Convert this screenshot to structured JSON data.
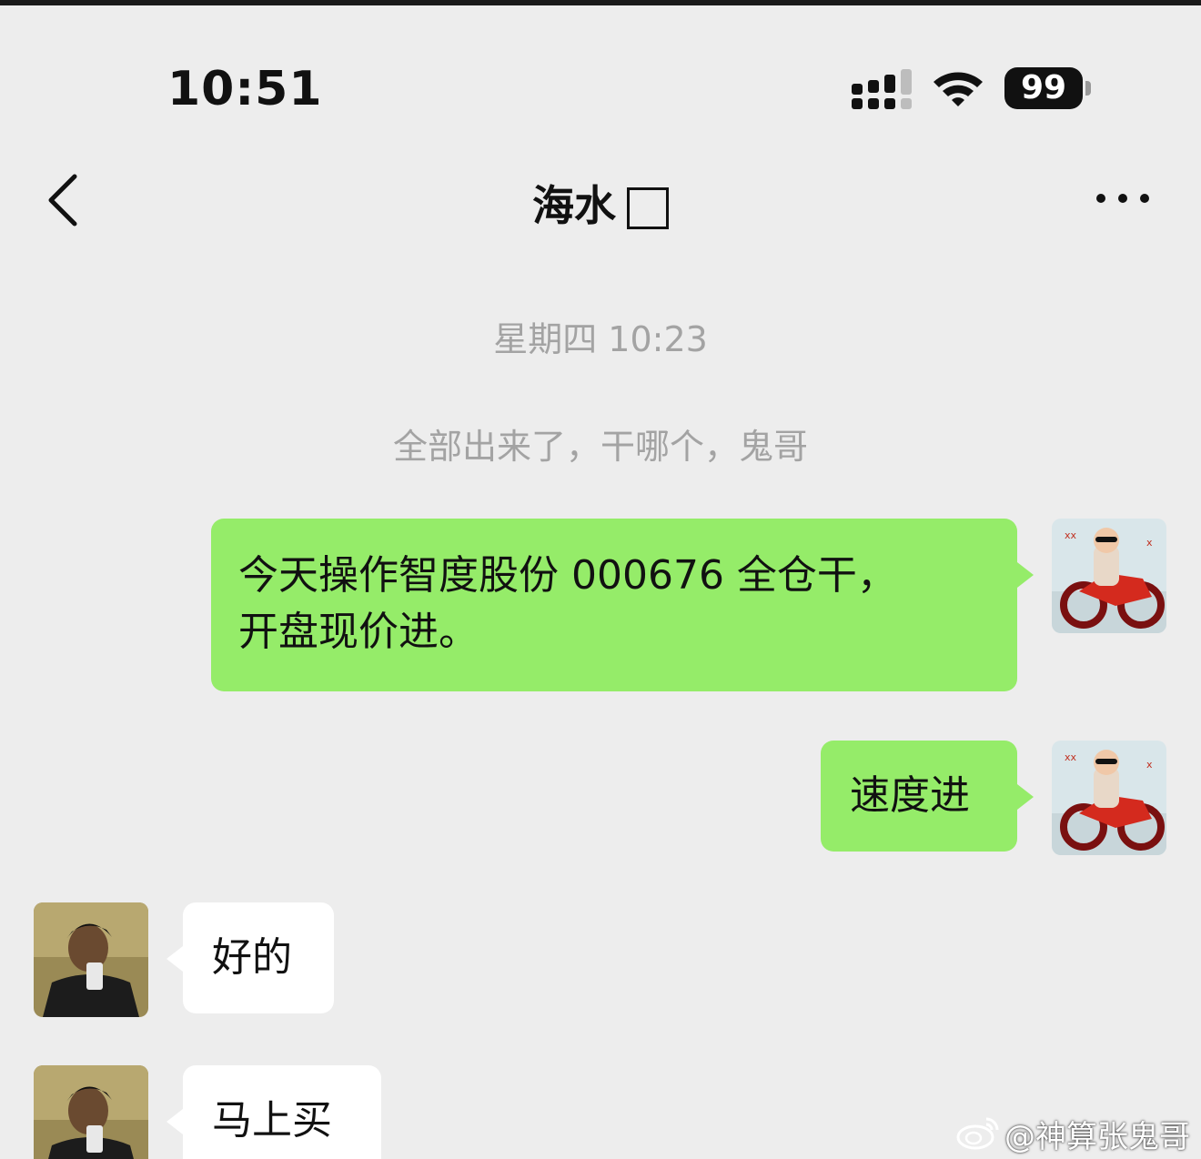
{
  "status_bar": {
    "time": "10:51",
    "battery": "99"
  },
  "nav": {
    "title": "海水"
  },
  "chat": {
    "timestamp": "星期四 10:23",
    "system_message": "全部出来了，干哪个，鬼哥",
    "messages": [
      {
        "side": "right",
        "line1": "今天操作智度股份 000676 全仓干，",
        "line2": "开盘现价进。"
      },
      {
        "side": "right",
        "text": "速度进"
      },
      {
        "side": "left",
        "text": "好的"
      },
      {
        "side": "left",
        "text": "马上买"
      }
    ]
  },
  "watermark": {
    "text": "@神算张鬼哥"
  },
  "colors": {
    "background": "#ededed",
    "self_bubble": "#95ec69",
    "other_bubble": "#ffffff",
    "system_text": "#a3a3a3"
  }
}
